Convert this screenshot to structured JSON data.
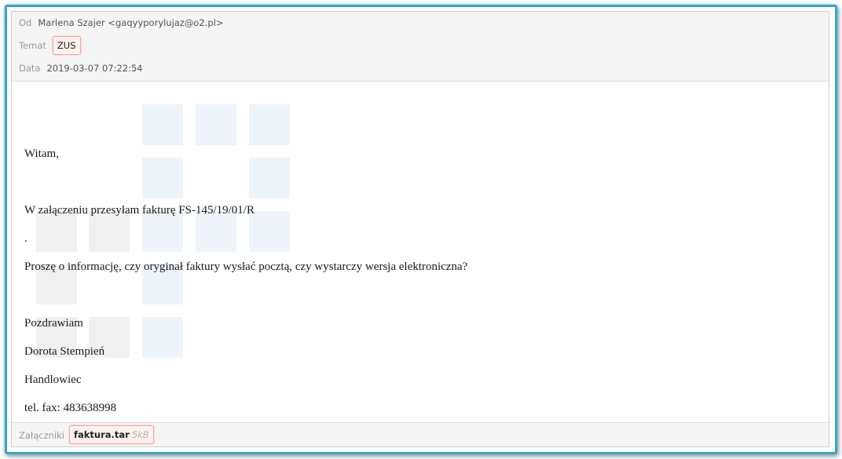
{
  "header": {
    "from_label": "Od",
    "from_value": "Marlena Szajer <gaqyyporylujaz@o2.pl>",
    "subject_label": "Temat",
    "subject_value": "ZUS",
    "date_label": "Data",
    "date_value": "2019-03-07 07:22:54"
  },
  "body": {
    "lines": [
      "Witam,",
      "W załączeniu przesyłam fakturę FS-145/19/01/R",
      ".",
      "Proszę o informację, czy oryginał faktury wysłać pocztą, czy wystarczy wersja elektroniczna?",
      "Pozdrawiam",
      "Dorota Stempień",
      "Handlowiec",
      "tel. fax: 483638998"
    ]
  },
  "footer": {
    "attachments_label": "Załączniki",
    "attachment_name": "faktura.tar",
    "attachment_size": "5kB"
  },
  "colors": {
    "frame_border": "#3aa6c7",
    "badge_border": "#f3a8a0",
    "badge_background": "#fff1ef"
  }
}
